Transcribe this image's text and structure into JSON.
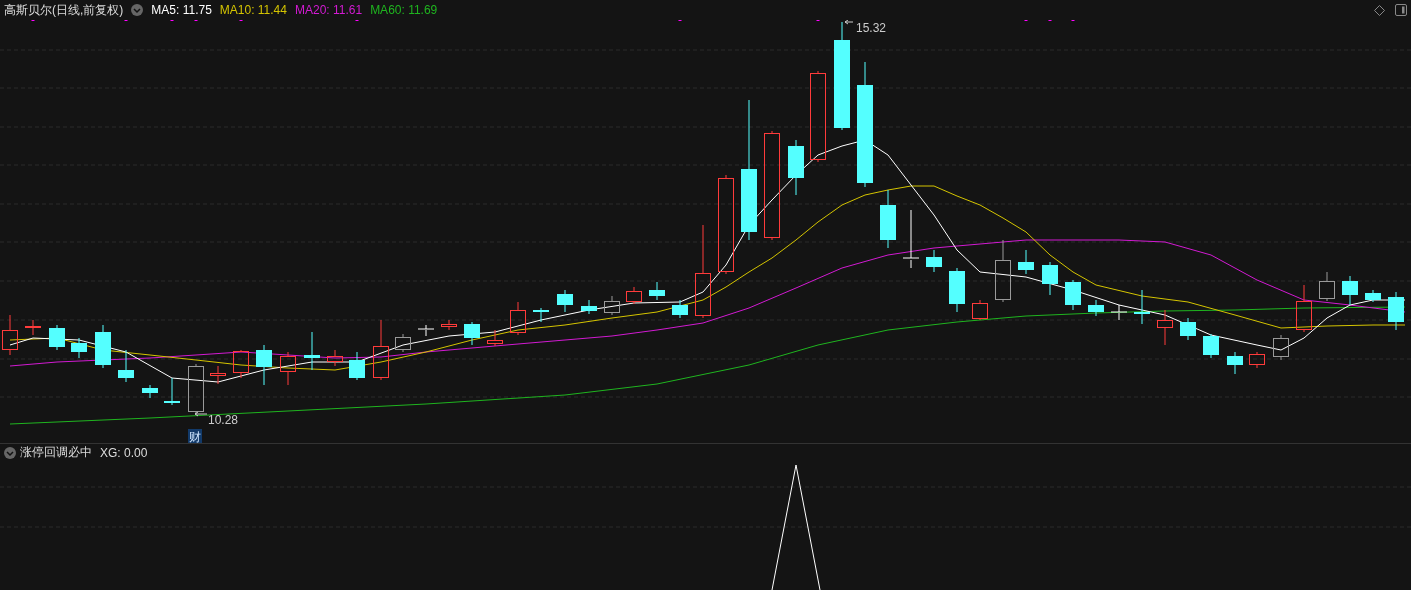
{
  "chart": {
    "title": "高斯贝尔(日线,前复权)",
    "ma_labels": [
      {
        "label": "MA5: 11.75",
        "color": "#ffffff"
      },
      {
        "label": "MA10: 11.44",
        "color": "#d4c400"
      },
      {
        "label": "MA20: 11.61",
        "color": "#d21ad2"
      },
      {
        "label": "MA60: 11.69",
        "color": "#1fb41f"
      }
    ],
    "high_marker": "15.32",
    "low_marker": "10.28",
    "event_badge": "财"
  },
  "indicator": {
    "title": "涨停回调必中",
    "reading": "XG: 0.00"
  }
}
